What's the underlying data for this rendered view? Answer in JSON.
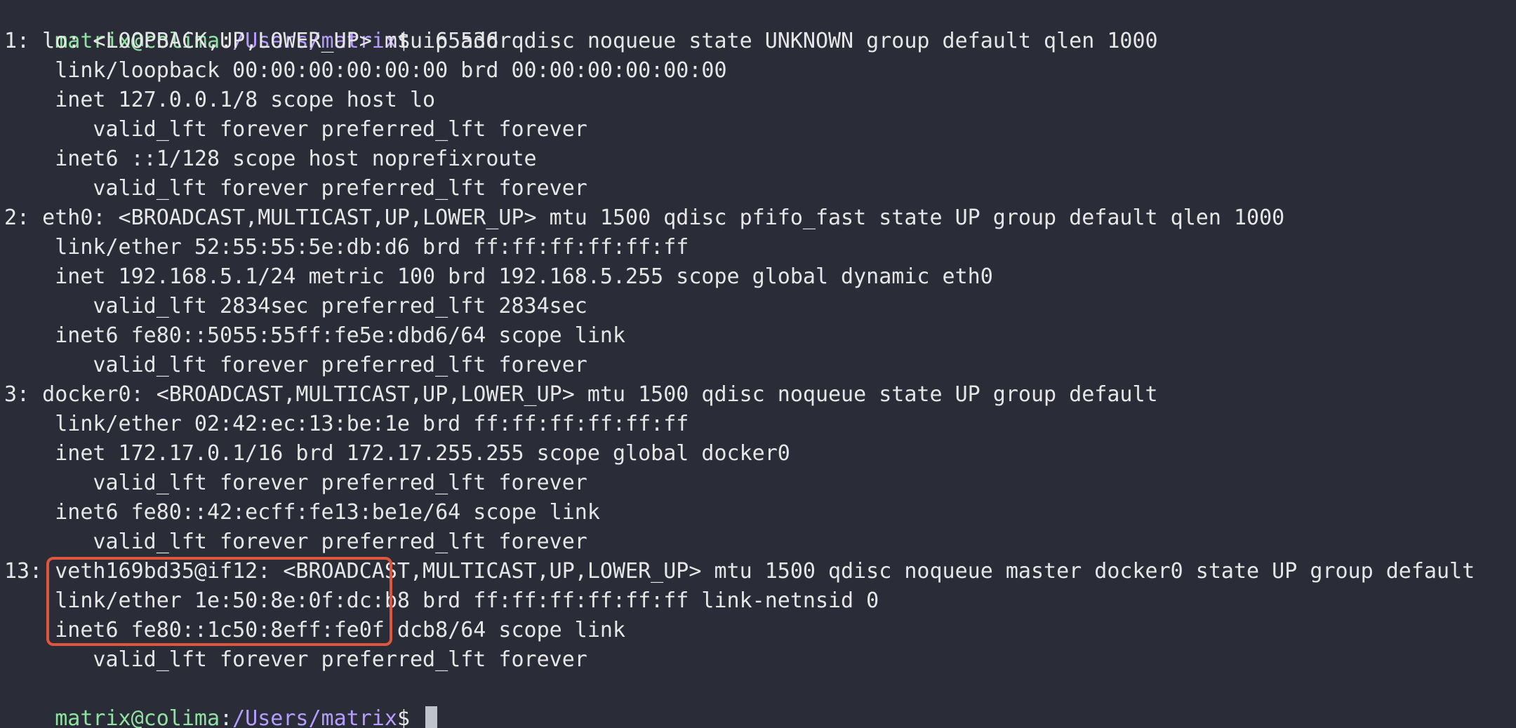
{
  "prompt": {
    "user_host": "matrix@colima",
    "colon": ":",
    "path": "/Users/matrix",
    "symbol": "$ ",
    "command": "ip addr"
  },
  "output_lines": [
    "1: lo: <LOOPBACK,UP,LOWER_UP> mtu 65536 qdisc noqueue state UNKNOWN group default qlen 1000",
    "    link/loopback 00:00:00:00:00:00 brd 00:00:00:00:00:00",
    "    inet 127.0.0.1/8 scope host lo",
    "       valid_lft forever preferred_lft forever",
    "    inet6 ::1/128 scope host noprefixroute",
    "       valid_lft forever preferred_lft forever",
    "2: eth0: <BROADCAST,MULTICAST,UP,LOWER_UP> mtu 1500 qdisc pfifo_fast state UP group default qlen 1000",
    "    link/ether 52:55:55:5e:db:d6 brd ff:ff:ff:ff:ff:ff",
    "    inet 192.168.5.1/24 metric 100 brd 192.168.5.255 scope global dynamic eth0",
    "       valid_lft 2834sec preferred_lft 2834sec",
    "    inet6 fe80::5055:55ff:fe5e:dbd6/64 scope link",
    "       valid_lft forever preferred_lft forever",
    "3: docker0: <BROADCAST,MULTICAST,UP,LOWER_UP> mtu 1500 qdisc noqueue state UP group default",
    "    link/ether 02:42:ec:13:be:1e brd ff:ff:ff:ff:ff:ff",
    "    inet 172.17.0.1/16 brd 172.17.255.255 scope global docker0",
    "       valid_lft forever preferred_lft forever",
    "    inet6 fe80::42:ecff:fe13:be1e/64 scope link",
    "       valid_lft forever preferred_lft forever",
    "13: veth169bd35@if12: <BROADCAST,MULTICAST,UP,LOWER_UP> mtu 1500 qdisc noqueue master docker0 state UP group default",
    "    link/ether 1e:50:8e:0f:dc:b8 brd ff:ff:ff:ff:ff:ff link-netnsid 0",
    "    inet6 fe80::1c50:8eff:fe0f:dcb8/64 scope link",
    "       valid_lft forever preferred_lft forever"
  ],
  "colors": {
    "background": "#2a2d37",
    "user_host": "#8fe3a0",
    "path": "#b79cff",
    "text": "#e6e6e6",
    "highlight_border": "#e0553d"
  },
  "icons": {
    "cursor": "block-cursor"
  }
}
